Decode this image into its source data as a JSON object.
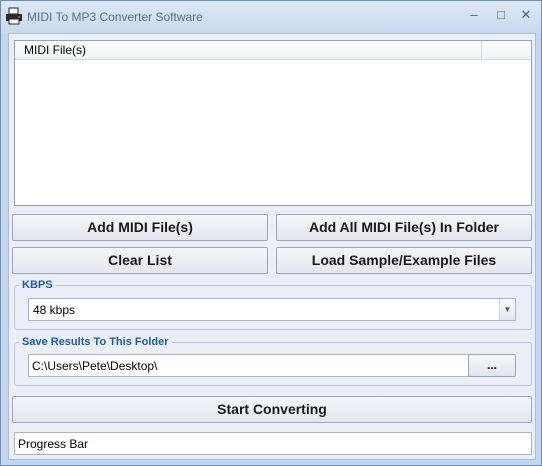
{
  "window": {
    "title": "MIDI To MP3 Converter Software",
    "app_icon": "printer-icon",
    "controls": {
      "minimize": "–",
      "maximize": "□",
      "close": "✕"
    }
  },
  "file_list": {
    "columns": [
      "MIDI File(s)",
      ""
    ],
    "rows": []
  },
  "buttons": {
    "add_files": "Add MIDI File(s)",
    "add_folder": "Add All MIDI File(s) In Folder",
    "clear_list": "Clear List",
    "load_samples": "Load Sample/Example Files",
    "start": "Start Converting"
  },
  "kbps": {
    "label": "KBPS",
    "selected": "48 kbps"
  },
  "output": {
    "label": "Save Results To This Folder",
    "path": "C:\\Users\\Pete\\Desktop\\",
    "browse_label": "..."
  },
  "progress": {
    "label": "Progress Bar"
  },
  "colors": {
    "accent": "#1f5aa8",
    "window_frame": "#c2d5ec",
    "client_bg": "#e9eef7"
  }
}
